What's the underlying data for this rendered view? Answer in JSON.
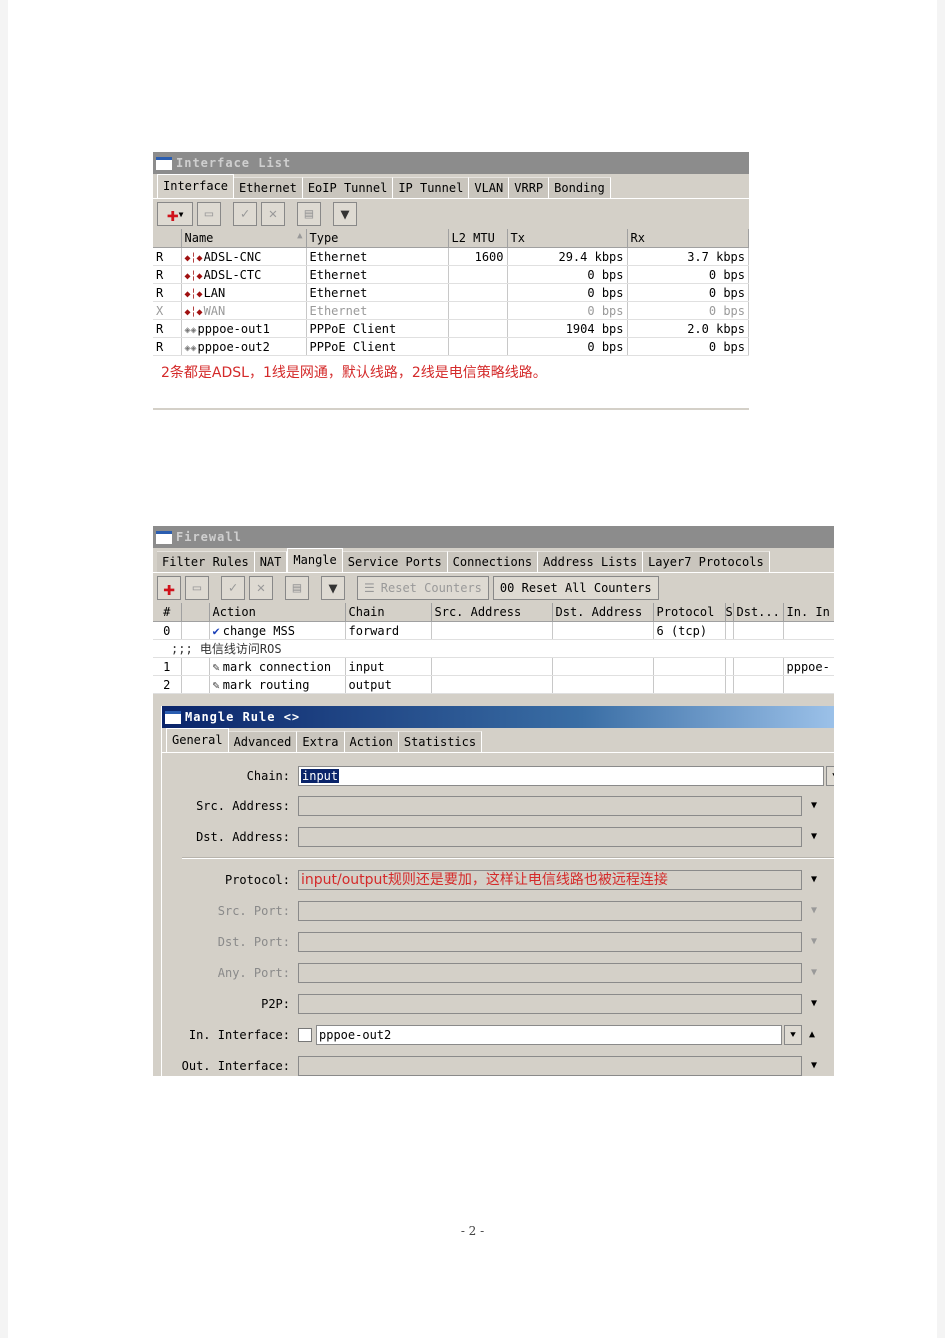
{
  "interface_window": {
    "title": "Interface List",
    "tabs": [
      "Interface",
      "Ethernet",
      "EoIP Tunnel",
      "IP Tunnel",
      "VLAN",
      "VRRP",
      "Bonding"
    ],
    "active_tab": "Interface",
    "toolbar": {
      "add_icon": "plus-dropdown-icon",
      "remove_icon": "minus-icon",
      "enable_icon": "check-icon",
      "disable_icon": "x-icon",
      "comment_icon": "note-icon",
      "filter_icon": "funnel-icon"
    },
    "columns": [
      "",
      "Name",
      "Type",
      "L2 MTU",
      "Tx",
      "Rx"
    ],
    "rows": [
      {
        "flag": "R",
        "icon": "ethernet-icon",
        "name": "ADSL-CNC",
        "type": "Ethernet",
        "l2mtu": "1600",
        "tx": "29.4 kbps",
        "rx": "3.7 kbps",
        "disabled": false
      },
      {
        "flag": "R",
        "icon": "ethernet-icon",
        "name": "ADSL-CTC",
        "type": "Ethernet",
        "l2mtu": "",
        "tx": "0 bps",
        "rx": "0 bps",
        "disabled": false
      },
      {
        "flag": "R",
        "icon": "ethernet-icon",
        "name": "LAN",
        "type": "Ethernet",
        "l2mtu": "",
        "tx": "0 bps",
        "rx": "0 bps",
        "disabled": false
      },
      {
        "flag": "X",
        "icon": "ethernet-icon",
        "name": "WAN",
        "type": "Ethernet",
        "l2mtu": "",
        "tx": "0 bps",
        "rx": "0 bps",
        "disabled": true
      },
      {
        "flag": "R",
        "icon": "pppoe-icon",
        "name": "pppoe-out1",
        "type": "PPPoE Client",
        "l2mtu": "",
        "tx": "1904 bps",
        "rx": "2.0 kbps",
        "disabled": false
      },
      {
        "flag": "R",
        "icon": "pppoe-icon",
        "name": "pppoe-out2",
        "type": "PPPoE Client",
        "l2mtu": "",
        "tx": "0 bps",
        "rx": "0 bps",
        "disabled": false
      }
    ],
    "annotation": "2条都是ADSL，1线是网通，默认线路，2线是电信策略线路。"
  },
  "firewall_window": {
    "title": "Firewall",
    "tabs": [
      "Filter Rules",
      "NAT",
      "Mangle",
      "Service Ports",
      "Connections",
      "Address Lists",
      "Layer7 Protocols"
    ],
    "active_tab": "Mangle",
    "toolbar": {
      "reset_counters": "Reset Counters",
      "reset_all_counters": "00 Reset All Counters"
    },
    "columns": [
      "#",
      "",
      "Action",
      "Chain",
      "Src. Address",
      "Dst. Address",
      "Protocol",
      "S",
      "Dst...",
      "In. In"
    ],
    "rows": [
      {
        "num": "0",
        "icon": "check-icon",
        "action": "change MSS",
        "chain": "forward",
        "src": "",
        "dst": "",
        "protocol": "6 (tcp)",
        "s": "",
        "dstport": "",
        "in": ""
      },
      {
        "comment": ";;; 电信线访问ROS"
      },
      {
        "num": "1",
        "icon": "pencil-icon",
        "action": "mark connection",
        "chain": "input",
        "src": "",
        "dst": "",
        "protocol": "",
        "s": "",
        "dstport": "",
        "in": "pppoe-"
      },
      {
        "num": "2",
        "icon": "pencil-icon",
        "action": "mark routing",
        "chain": "output",
        "src": "",
        "dst": "",
        "protocol": "",
        "s": "",
        "dstport": "",
        "in": ""
      }
    ]
  },
  "mangle_rule_window": {
    "title": "Mangle Rule <>",
    "tabs": [
      "General",
      "Advanced",
      "Extra",
      "Action",
      "Statistics"
    ],
    "active_tab": "General",
    "fields": {
      "chain": {
        "label": "Chain:",
        "value": "input"
      },
      "src_address": {
        "label": "Src. Address:",
        "value": ""
      },
      "dst_address": {
        "label": "Dst. Address:",
        "value": ""
      },
      "protocol": {
        "label": "Protocol:",
        "value": "input/output规则还是要加，这样让电信线路也被远程连接"
      },
      "src_port": {
        "label": "Src. Port:",
        "value": ""
      },
      "dst_port": {
        "label": "Dst. Port:",
        "value": ""
      },
      "any_port": {
        "label": "Any. Port:",
        "value": ""
      },
      "p2p": {
        "label": "P2P:",
        "value": ""
      },
      "in_interface": {
        "label": "In. Interface:",
        "value": "pppoe-out2",
        "negate": false
      },
      "out_interface": {
        "label": "Out. Interface:",
        "value": ""
      }
    }
  },
  "page_number": "- 2 -"
}
